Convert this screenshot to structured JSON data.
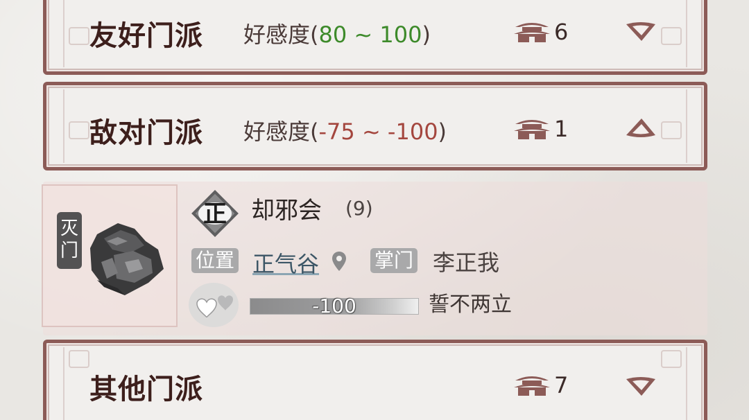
{
  "sections": {
    "friendly": {
      "title": "友好门派",
      "affinity_prefix": "好感度(",
      "affinity_range": "80 ~ 100",
      "affinity_suffix": ")",
      "count": "6",
      "expanded": false
    },
    "hostile": {
      "title": "敌对门派",
      "affinity_prefix": "好感度(",
      "affinity_range": "-75 ~ -100",
      "affinity_suffix": ")",
      "count": "1",
      "expanded": true
    },
    "other": {
      "title": "其他门派",
      "count": "7",
      "expanded": false
    }
  },
  "sect": {
    "status_tag": "灭门",
    "alignment_char": "正",
    "name": "却邪会",
    "level": "(9)",
    "location_label": "位置",
    "location": "正气谷",
    "leader_label": "掌门",
    "leader": "李正我",
    "affinity_value": "-100",
    "affinity_fraction": 0.0,
    "relation": "誓不两立"
  },
  "colors": {
    "frame": "#8c5b57",
    "positive": "#3d8a2a",
    "negative": "#a4463e",
    "title": "#3d1f1c",
    "link": "#3c5666"
  },
  "icons": {
    "sect_count": "pagoda-icon",
    "collapse": "chevron-down-icon",
    "expand": "chevron-up-icon",
    "location": "map-pin-icon",
    "affinity": "hearts-icon"
  }
}
